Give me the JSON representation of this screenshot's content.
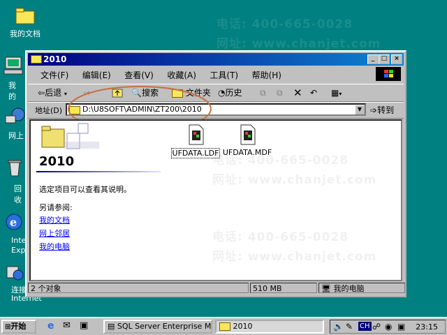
{
  "desktop": {
    "icons": [
      {
        "label": "我的文档"
      },
      {
        "label": "我的"
      },
      {
        "label": "网上"
      },
      {
        "label": "回收"
      },
      {
        "label": "Inte Expl"
      },
      {
        "label": "连接 Internet"
      }
    ],
    "watermark": {
      "phone": "电话: 400-665-0028",
      "site": "网址: www.chanjet.com"
    }
  },
  "window": {
    "title": "2010",
    "controls": {
      "minimize": "_",
      "maximize": "□",
      "close": "×"
    },
    "menu": [
      "文件(F)",
      "编辑(E)",
      "查看(V)",
      "收藏(A)",
      "工具(T)",
      "帮助(H)"
    ],
    "toolbar": {
      "back": "后退",
      "search": "搜索",
      "folders": "文件夹",
      "history": "历史"
    },
    "address": {
      "label": "地址(D)",
      "value": "D:\\U8SOFT\\ADMIN\\ZT200\\2010",
      "go": "转到"
    },
    "panel": {
      "folder_title": "2010",
      "prompt": "选定项目可以查看其说明。",
      "see_also": "另请参阅:",
      "links": [
        "我的文档",
        "网上邻居",
        "我的电脑"
      ]
    },
    "files": [
      {
        "name": "UFDATA.LDF"
      },
      {
        "name": "UFDATA.MDF"
      }
    ],
    "status": {
      "objects": "2 个对象",
      "size": "510 MB",
      "location": "我的电脑"
    }
  },
  "taskbar": {
    "start": "开始",
    "tasks": [
      "SQL Server Enterprise M...",
      "2010"
    ],
    "tray": {
      "lang": "CH",
      "time": "23:15"
    }
  },
  "colors": {
    "desktop": "#008080",
    "title_active": "#000080",
    "annotation": "#c87040"
  }
}
